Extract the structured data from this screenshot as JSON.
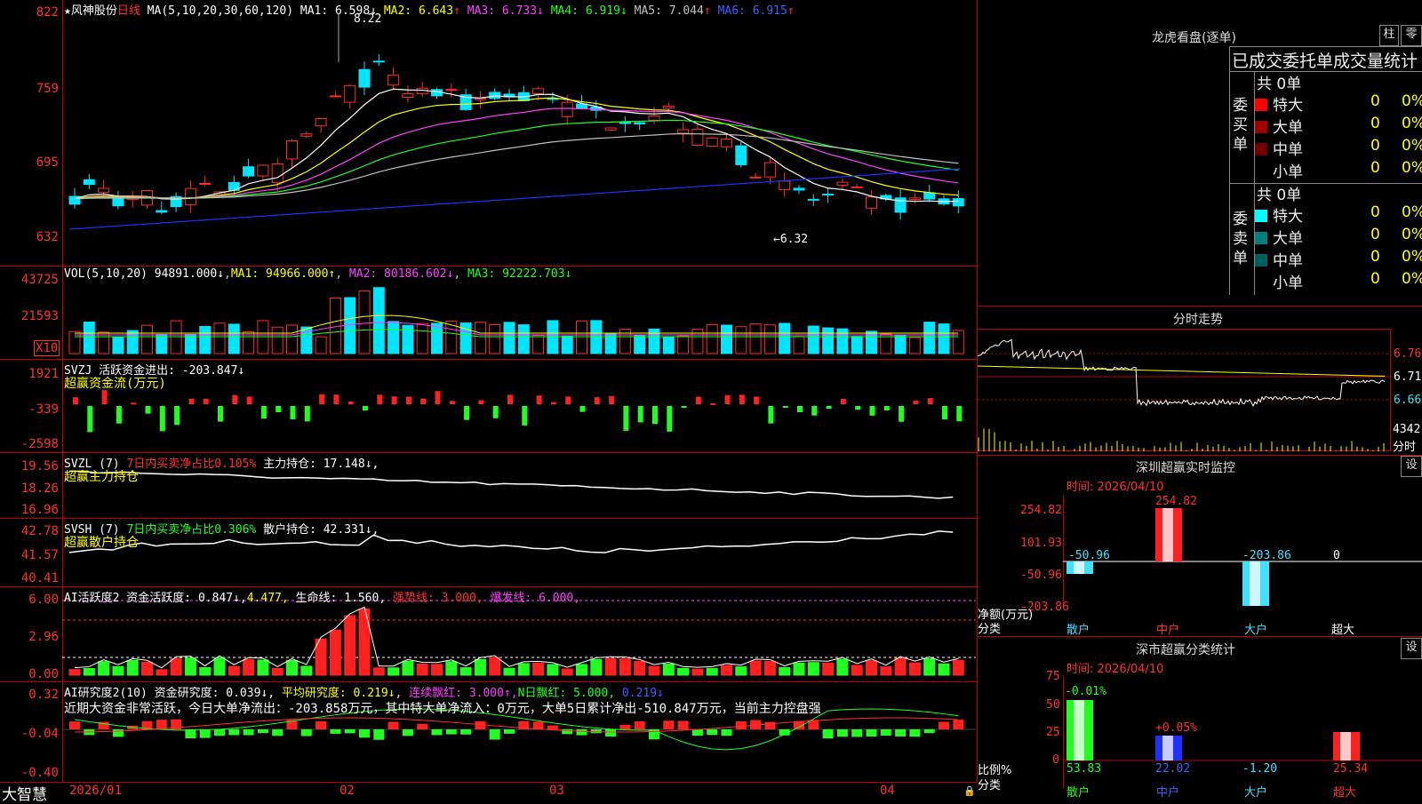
{
  "stock": {
    "name": "★风神股份",
    "period": "日线",
    "ma_label": "MA(5,10,20,30,60,120)",
    "ma": [
      {
        "k": "MA1",
        "v": "6.598",
        "a": "↓"
      },
      {
        "k": "MA2",
        "v": "6.643",
        "a": "↑"
      },
      {
        "k": "MA3",
        "v": "6.733",
        "a": "↓"
      },
      {
        "k": "MA4",
        "v": "6.919",
        "a": "↓"
      },
      {
        "k": "MA5",
        "v": "7.044",
        "a": "↑"
      },
      {
        "k": "MA6",
        "v": "6.915",
        "a": "↑"
      }
    ],
    "high_mark": "8.22",
    "low_mark": "←6.32",
    "price_ticks": [
      "822",
      "759",
      "695",
      "632"
    ]
  },
  "vol": {
    "label": "VOL(5,10,20)",
    "value": "94891.000↓",
    "ma1": "MA1: 94966.000↑",
    "ma2": "MA2: 80186.602↓",
    "ma3": "MA3: 92222.703↓",
    "ticks": [
      "43725",
      "21593"
    ],
    "unit": "X10"
  },
  "svzj": {
    "label": "SVZJ  活跃资金进出: -203.847↓",
    "sub": "超赢资金流(万元)",
    "ticks": [
      "1921",
      "-339",
      "-2598"
    ]
  },
  "svzl": {
    "label": "SVZL (7) ",
    "l2": "7日内买卖净占比0.105%",
    "l3": "主力持仓: 17.148↓,",
    "sub": "超赢主力持仓",
    "ticks": [
      "19.56",
      "18.26",
      "16.96"
    ]
  },
  "svsh": {
    "label": "SVSH (7) ",
    "l2": "7日内买卖净占比0.306%",
    "l3": "散户持仓: 42.331↓,",
    "sub": "超赢散户持仓",
    "ticks": [
      "42.78",
      "41.57",
      "40.41"
    ]
  },
  "ai1": {
    "label": "AI活跃度2 资金活跃度: 0.847↓,",
    "v2": "4.477,",
    "v3": "生命线: 1.560,",
    "v4": "强势线: 3.000,",
    "v5": "爆发线: 6.000,",
    "ticks": [
      "6.00",
      "2.96",
      "0.00"
    ]
  },
  "ai2": {
    "label": "AI研究度2(10) 资金研究度: 0.039↓,",
    "v2": "平均研究度: 0.219↓,",
    "v3": "连续飘红: 3.000↑,",
    "v4": "N日飘红: 5.000,",
    "v5": "0.219↓",
    "ticks": [
      "0.32",
      "-0.04",
      "-0.40"
    ],
    "note": "近期大资金非常活跃，今日大单净流出：-203.858万元，其中特大单净流入：0万元，大单5日累计净出-510.847万元，当前主力控盘强"
  },
  "xaxis": {
    "brand": "大智慧",
    "dates": [
      "2026/01",
      "02",
      "03",
      "04"
    ]
  },
  "lhb": {
    "title": "龙虎看盘(逐单)",
    "btn1": "柱",
    "btn2": "零",
    "header": "已成交委托单成交量统计",
    "buy": {
      "side": "委买单",
      "total": "共 0单",
      "rows": [
        {
          "n": "特大",
          "c": "0",
          "p": "0%",
          "col": "#ff0000"
        },
        {
          "n": "大单",
          "c": "0",
          "p": "0%",
          "col": "#a00000"
        },
        {
          "n": "中单",
          "c": "0",
          "p": "0%",
          "col": "#700000"
        },
        {
          "n": "小单",
          "c": "0",
          "p": "0%",
          "col": "#000000"
        }
      ]
    },
    "sell": {
      "side": "委卖单",
      "total": "共 0单",
      "rows": [
        {
          "n": "特大",
          "c": "0",
          "p": "0%",
          "col": "#00ffff"
        },
        {
          "n": "大单",
          "c": "0",
          "p": "0%",
          "col": "#008080"
        },
        {
          "n": "中单",
          "c": "0",
          "p": "0%",
          "col": "#006060"
        },
        {
          "n": "小单",
          "c": "0",
          "p": "0%",
          "col": "#000000"
        }
      ]
    }
  },
  "minute": {
    "title": "分时走势",
    "ticks": [
      "6.76",
      "6.71",
      "6.66"
    ],
    "vol": "4342",
    "vol_lbl": "分时"
  },
  "sz_monitor": {
    "title": "深圳超赢实时监控",
    "btn": "设",
    "time": "时间: 2026/04/10",
    "ticks": [
      "254.82",
      "101.93",
      "-50.96",
      "-203.86"
    ],
    "bars": [
      {
        "cat": "散户",
        "v": "-50.96"
      },
      {
        "cat": "中户",
        "v": "254.82"
      },
      {
        "cat": "大户",
        "v": "-203.86"
      },
      {
        "cat": "超大",
        "v": "0"
      }
    ],
    "ylbl": "净额(万元)",
    "xlbl": "分类"
  },
  "sz_class": {
    "title": "深市超赢分类统计",
    "btn": "设",
    "time": "时间: 2026/04/10",
    "ticks": [
      "75",
      "50",
      "25",
      "0"
    ],
    "bars": [
      {
        "cat": "散户",
        "top": "-0.01%",
        "bot": "53.83"
      },
      {
        "cat": "中户",
        "top": "+0.05%",
        "bot": "22.02"
      },
      {
        "cat": "大户",
        "top": "",
        "bot": "-1.20"
      },
      {
        "cat": "超大",
        "top": "",
        "bot": "25.34"
      }
    ],
    "ylbl": "比例%",
    "xlbl": "分类"
  }
}
